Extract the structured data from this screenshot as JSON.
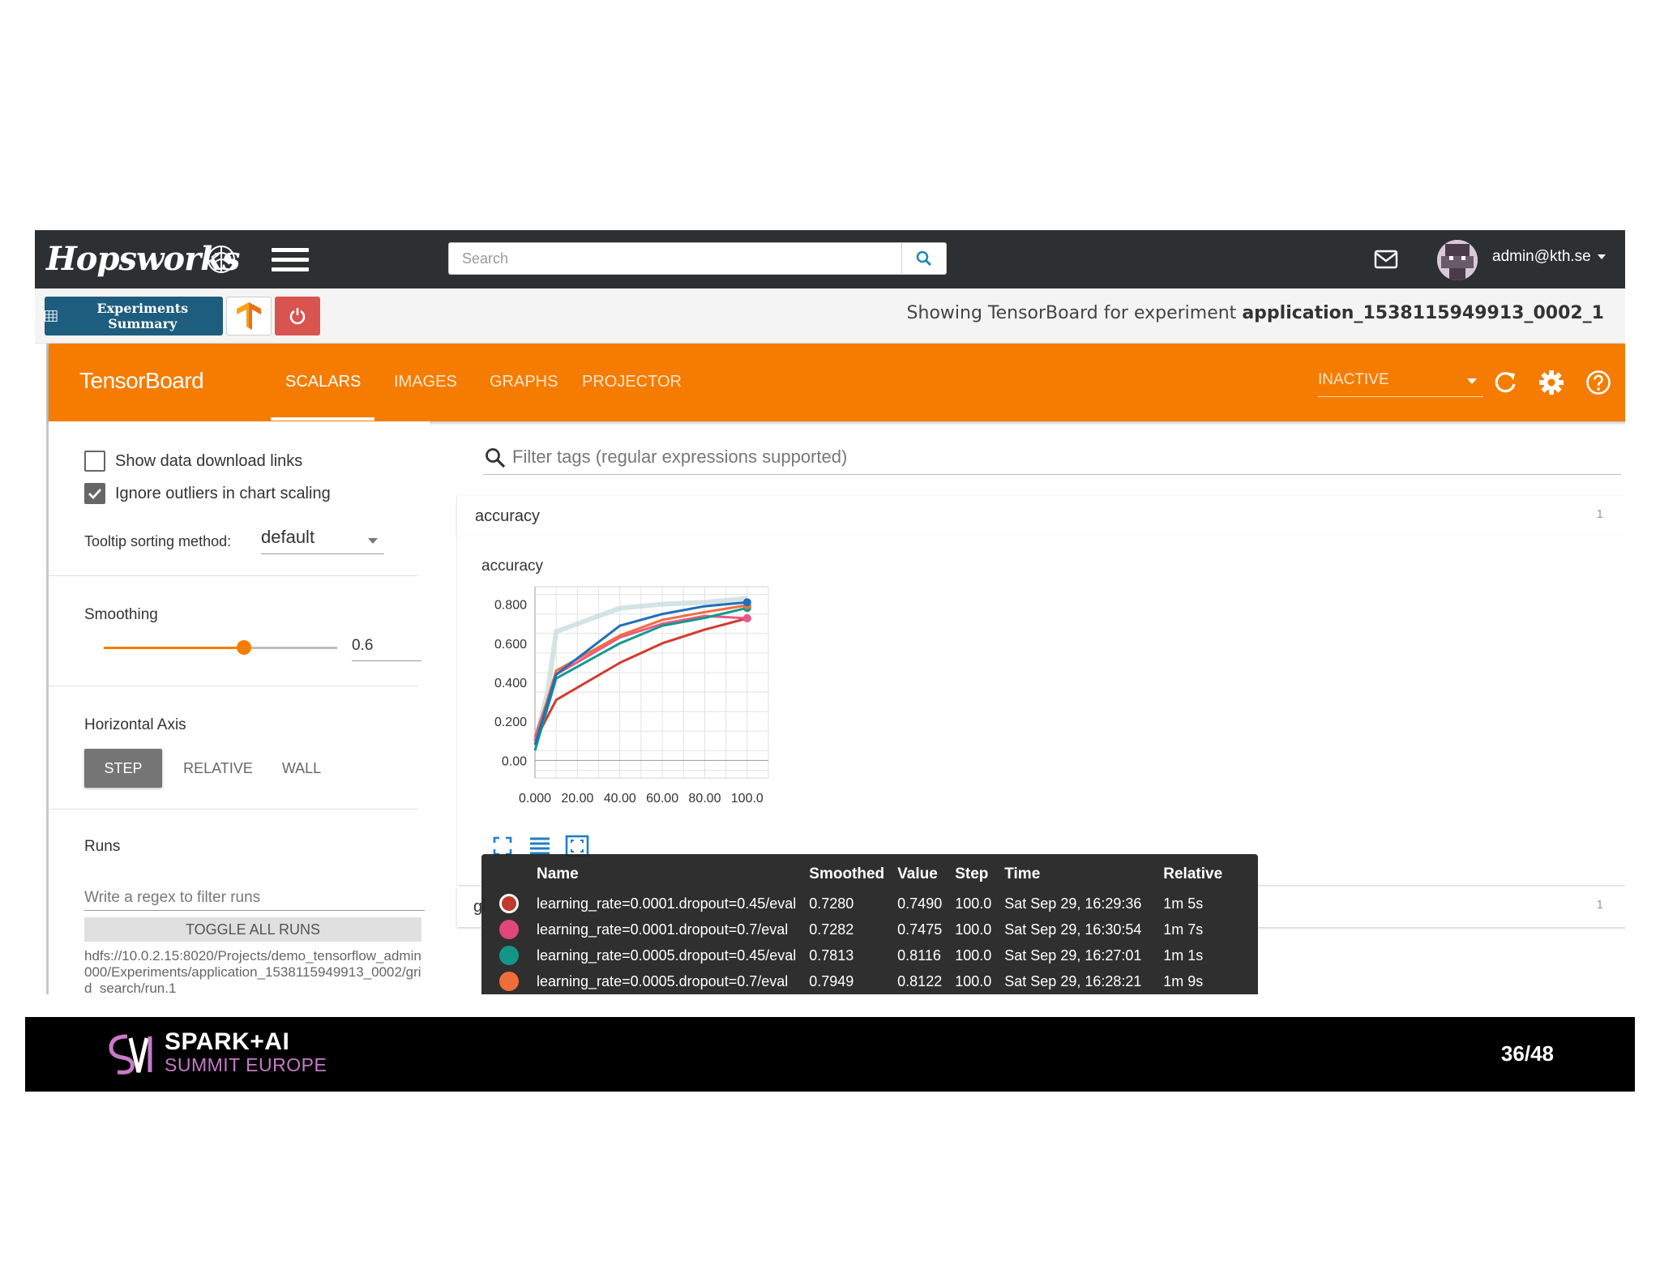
{
  "navbar": {
    "logo": "Hopsworks",
    "search_placeholder": "Search",
    "user": "admin@kth.se",
    "icons": [
      "hops-logo-icon",
      "hamburger-menu-icon",
      "search-icon",
      "mail-icon",
      "chevron-down-icon"
    ]
  },
  "toolbar": {
    "experiments_summary_label": "Experiments Summary",
    "caption_prefix": "Showing TensorBoard for experiment ",
    "experiment_id": "application_1538115949913_0002_1",
    "icons": [
      "grid-icon",
      "tensorflow-icon",
      "power-icon"
    ],
    "colors": {
      "summary_button": "#1d5d7e",
      "power_button": "#d9534f"
    }
  },
  "tensorboard": {
    "title": "TensorBoard",
    "tabs": [
      "SCALARS",
      "IMAGES",
      "GRAPHS",
      "PROJECTOR"
    ],
    "active_tab": "SCALARS",
    "status_select": "INACTIVE",
    "icons": [
      "refresh-icon",
      "gear-icon",
      "help-icon"
    ],
    "colors": {
      "header": "#f57c00"
    }
  },
  "sidebar": {
    "show_download_links": {
      "label": "Show data download links",
      "checked": false
    },
    "ignore_outliers": {
      "label": "Ignore outliers in chart scaling",
      "checked": true
    },
    "tooltip_sorting_label": "Tooltip sorting method:",
    "tooltip_sorting_value": "default",
    "smoothing_label": "Smoothing",
    "smoothing_value": "0.6",
    "smoothing_fraction": 0.6,
    "horizontal_axis_label": "Horizontal Axis",
    "axis_options": [
      "STEP",
      "RELATIVE",
      "WALL"
    ],
    "axis_selected": "STEP",
    "runs_label": "Runs",
    "runs_filter_placeholder": "Write a regex to filter runs",
    "toggle_all_label": "TOGGLE ALL RUNS",
    "run_path": "hdfs://10.0.2.15:8020/Projects/demo_tensorflow_admin000/Experiments/application_1538115949913_0002/grid_search/run.1"
  },
  "main": {
    "tag_filter_placeholder": "Filter tags (regular expressions supported)",
    "category_name": "accuracy",
    "category_count": "1",
    "second_category_count": "1",
    "second_category_name_partial": "gl",
    "chart_tools": [
      "fit-domain-icon",
      "data-list-icon",
      "zoom-select-icon"
    ]
  },
  "chart_data": {
    "type": "line",
    "title": "accuracy",
    "xlabel": "",
    "ylabel": "",
    "xlim": [
      0,
      110
    ],
    "ylim": [
      -0.09,
      0.89
    ],
    "x_ticks": [
      "0.000",
      "20.00",
      "40.00",
      "60.00",
      "80.00",
      "100.0"
    ],
    "y_ticks": [
      "0.00",
      "0.200",
      "0.400",
      "0.600",
      "0.800"
    ],
    "grid": true,
    "series": [
      {
        "name": "learning_rate=0.0001.dropout=0.45/eval",
        "color": "#d33b2e",
        "x": [
          0,
          10,
          40,
          60,
          80,
          100
        ],
        "y": [
          0.1,
          0.31,
          0.5,
          0.6,
          0.67,
          0.728
        ]
      },
      {
        "name": "learning_rate=0.0001.dropout=0.7/eval",
        "color": "#e8588c",
        "x": [
          0,
          10,
          40,
          60,
          80,
          100
        ],
        "y": [
          0.12,
          0.44,
          0.63,
          0.7,
          0.74,
          0.7282
        ]
      },
      {
        "name": "learning_rate=0.0005.dropout=0.45/eval",
        "color": "#14998a",
        "x": [
          0,
          10,
          40,
          60,
          80,
          100
        ],
        "y": [
          0.05,
          0.42,
          0.6,
          0.69,
          0.73,
          0.7813
        ]
      },
      {
        "name": "learning_rate=0.0005.dropout=0.7/eval",
        "color": "#f06e3c",
        "x": [
          0,
          10,
          40,
          60,
          80,
          100
        ],
        "y": [
          0.1,
          0.46,
          0.64,
          0.72,
          0.76,
          0.7949
        ]
      },
      {
        "name": "",
        "color": "#1f6fb8",
        "x": [
          0,
          10,
          40,
          60,
          80,
          100
        ],
        "y": [
          0.08,
          0.44,
          0.69,
          0.75,
          0.79,
          0.81
        ]
      }
    ]
  },
  "tooltip": {
    "headers": [
      "Name",
      "Smoothed",
      "Value",
      "Step",
      "Time",
      "Relative"
    ],
    "rows": [
      {
        "color": "#c0392b",
        "ring": true,
        "name": "learning_rate=0.0001.dropout=0.45/eval",
        "smoothed": "0.7280",
        "value": "0.7490",
        "step": "100.0",
        "time": "Sat Sep 29, 16:29:36",
        "relative": "1m 5s"
      },
      {
        "color": "#e0457b",
        "ring": false,
        "name": "learning_rate=0.0001.dropout=0.7/eval",
        "smoothed": "0.7282",
        "value": "0.7475",
        "step": "100.0",
        "time": "Sat Sep 29, 16:30:54",
        "relative": "1m 7s"
      },
      {
        "color": "#159588",
        "ring": false,
        "name": "learning_rate=0.0005.dropout=0.45/eval",
        "smoothed": "0.7813",
        "value": "0.8116",
        "step": "100.0",
        "time": "Sat Sep 29, 16:27:01",
        "relative": "1m 1s"
      },
      {
        "color": "#ee6e3a",
        "ring": false,
        "name": "learning_rate=0.0005.dropout=0.7/eval",
        "smoothed": "0.7949",
        "value": "0.8122",
        "step": "100.0",
        "time": "Sat Sep 29, 16:28:21",
        "relative": "1m 9s"
      }
    ]
  },
  "footer": {
    "brand_line1": "SPARK+AI",
    "brand_line2": "SUMMIT EUROPE",
    "page_number": "36/48",
    "colors": {
      "accent": "#c87ac8"
    }
  }
}
